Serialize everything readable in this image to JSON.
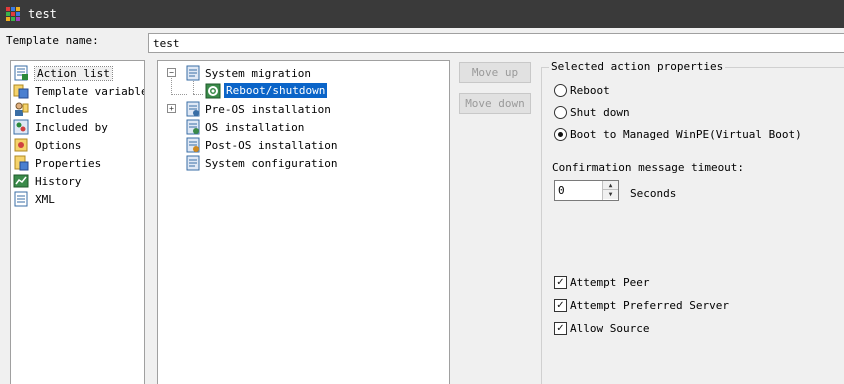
{
  "window": {
    "title": "test"
  },
  "template": {
    "name_label": "Template name:",
    "name_value": "test"
  },
  "nav": {
    "items": [
      {
        "label": "Action list",
        "icon": "action-list-icon",
        "selected": true
      },
      {
        "label": "Template variables",
        "icon": "template-variables-icon",
        "selected": false
      },
      {
        "label": "Includes",
        "icon": "includes-icon",
        "selected": false
      },
      {
        "label": "Included by",
        "icon": "included-by-icon",
        "selected": false
      },
      {
        "label": "Options",
        "icon": "options-icon",
        "selected": false
      },
      {
        "label": "Properties",
        "icon": "properties-icon",
        "selected": false
      },
      {
        "label": "History",
        "icon": "history-icon",
        "selected": false
      },
      {
        "label": "XML",
        "icon": "xml-icon",
        "selected": false
      }
    ]
  },
  "tree": {
    "nodes": [
      {
        "label": "System migration",
        "expanded": true,
        "children": [
          {
            "label": "Reboot/shutdown",
            "selected": true
          }
        ]
      },
      {
        "label": "Pre-OS installation",
        "expanded": false
      },
      {
        "label": "OS installation"
      },
      {
        "label": "Post-OS installation"
      },
      {
        "label": "System configuration"
      }
    ]
  },
  "buttons": {
    "move_up": "Move up",
    "move_down": "Move down"
  },
  "properties": {
    "title": "Selected action properties",
    "options": [
      {
        "label": "Reboot",
        "checked": false
      },
      {
        "label": "Shut down",
        "checked": false
      },
      {
        "label": "Boot to Managed WinPE(Virtual Boot)",
        "checked": true
      }
    ],
    "timeout_label": "Confirmation message timeout:",
    "timeout_value": "0",
    "timeout_unit": "Seconds",
    "checks": [
      {
        "label": "Attempt Peer",
        "checked": true
      },
      {
        "label": "Attempt Preferred Server",
        "checked": true
      },
      {
        "label": "Allow Source",
        "checked": true
      }
    ]
  },
  "colors": {
    "titlebar": "#3a3a3a",
    "selection": "#0a64c8"
  }
}
